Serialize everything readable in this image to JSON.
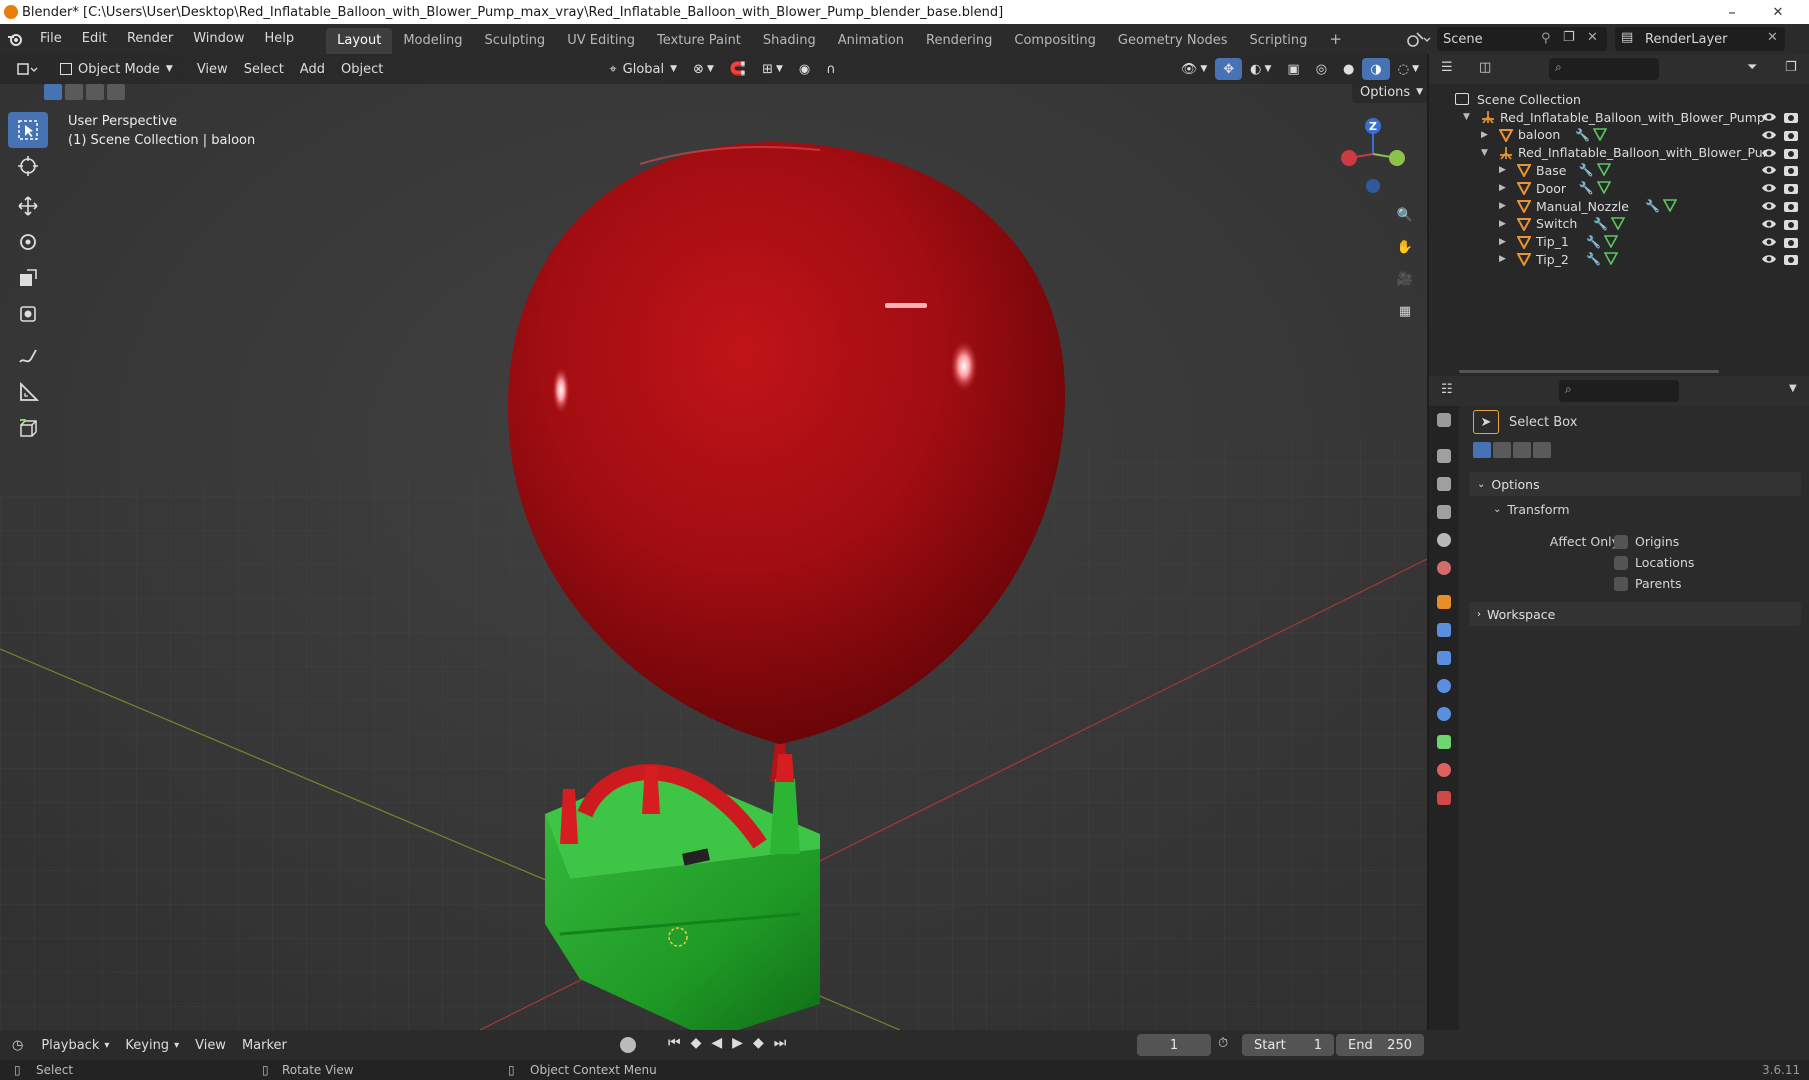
{
  "window": {
    "title": "Blender* [C:\\Users\\User\\Desktop\\Red_Inflatable_Balloon_with_Blower_Pump_max_vray\\Red_Inflatable_Balloon_with_Blower_Pump_blender_base.blend]",
    "minimize": "–",
    "restore": "❐",
    "close": "✕"
  },
  "menu": [
    "File",
    "Edit",
    "Render",
    "Window",
    "Help"
  ],
  "workspaces": [
    "Layout",
    "Modeling",
    "Sculpting",
    "UV Editing",
    "Texture Paint",
    "Shading",
    "Animation",
    "Rendering",
    "Compositing",
    "Geometry Nodes",
    "Scripting"
  ],
  "active_workspace": "Layout",
  "add_workspace": "+",
  "scene_name": "Scene",
  "render_layer": "RenderLayer",
  "viewport": {
    "mode": "Object Mode",
    "menus": [
      "View",
      "Select",
      "Add",
      "Object"
    ],
    "orientation": "Global",
    "options_label": "Options",
    "perspective_label": "User Perspective",
    "collection_label": "(1) Scene Collection | baloon",
    "gizmo_z": "Z",
    "accent": "#4772b3"
  },
  "toolbar": {
    "tools": [
      "select-box",
      "cursor",
      "move",
      "rotate",
      "scale",
      "transform",
      "annotate",
      "measure",
      "add-cube"
    ]
  },
  "outliner": {
    "root": "Scene Collection",
    "rows": [
      {
        "label": "Red_Inflatable_Balloon_with_Blower_Pump",
        "indent": 1,
        "type": "empty",
        "expanded": true
      },
      {
        "label": "baloon",
        "indent": 2,
        "type": "mesh",
        "expanded": false
      },
      {
        "label": "Red_Inflatable_Balloon_with_Blower_Pur",
        "indent": 2,
        "type": "empty",
        "expanded": true
      },
      {
        "label": "Base",
        "indent": 3,
        "type": "mesh",
        "expanded": false
      },
      {
        "label": "Door",
        "indent": 3,
        "type": "mesh",
        "expanded": false
      },
      {
        "label": "Manual_Nozzle",
        "indent": 3,
        "type": "mesh",
        "expanded": false
      },
      {
        "label": "Switch",
        "indent": 3,
        "type": "mesh",
        "expanded": false
      },
      {
        "label": "Tip_1",
        "indent": 3,
        "type": "mesh",
        "expanded": false
      },
      {
        "label": "Tip_2",
        "indent": 3,
        "type": "mesh",
        "expanded": false
      }
    ]
  },
  "properties": {
    "tool_name": "Select Box",
    "options_label": "Options",
    "transform_label": "Transform",
    "affect_only_label": "Affect Only",
    "checkboxes": [
      "Origins",
      "Locations",
      "Parents"
    ],
    "workspace_label": "Workspace"
  },
  "timeline": {
    "menus": [
      "Playback",
      "Keying",
      "View",
      "Marker"
    ],
    "current_frame": "1",
    "start_label": "Start",
    "start_value": "1",
    "end_label": "End",
    "end_value": "250"
  },
  "statusbar": {
    "select": "Select",
    "rotate_view": "Rotate View",
    "context_menu": "Object Context Menu",
    "version": "3.6.11"
  }
}
